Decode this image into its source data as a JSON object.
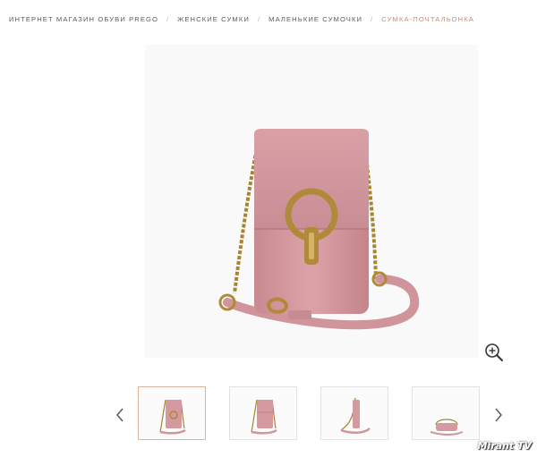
{
  "breadcrumb": {
    "items": [
      {
        "label": "ИНТЕРНЕТ МАГАЗИН ОБУВИ PREGO"
      },
      {
        "label": "ЖЕНСКИЕ СУМКИ"
      },
      {
        "label": "МАЛЕНЬКИЕ СУМОЧКИ"
      }
    ],
    "current": "СУМКА-ПОЧТАЛЬОНКА",
    "separator": "/"
  },
  "gallery": {
    "main_image": "pink leather phone crossbody bag with gold ring clasp and chain strap",
    "zoom_icon": "zoom-in-icon",
    "prev_icon": "chevron-left-icon",
    "next_icon": "chevron-right-icon",
    "thumbnails": [
      {
        "view": "front",
        "active": true
      },
      {
        "view": "back",
        "active": false
      },
      {
        "view": "side",
        "active": false
      },
      {
        "view": "bottom",
        "active": false
      }
    ]
  },
  "watermark": "Mirant TV",
  "colors": {
    "accent": "#c98d6f",
    "bag_pink": "#d49aa0",
    "gold": "#b08a3a",
    "text": "#5a5a5a"
  }
}
